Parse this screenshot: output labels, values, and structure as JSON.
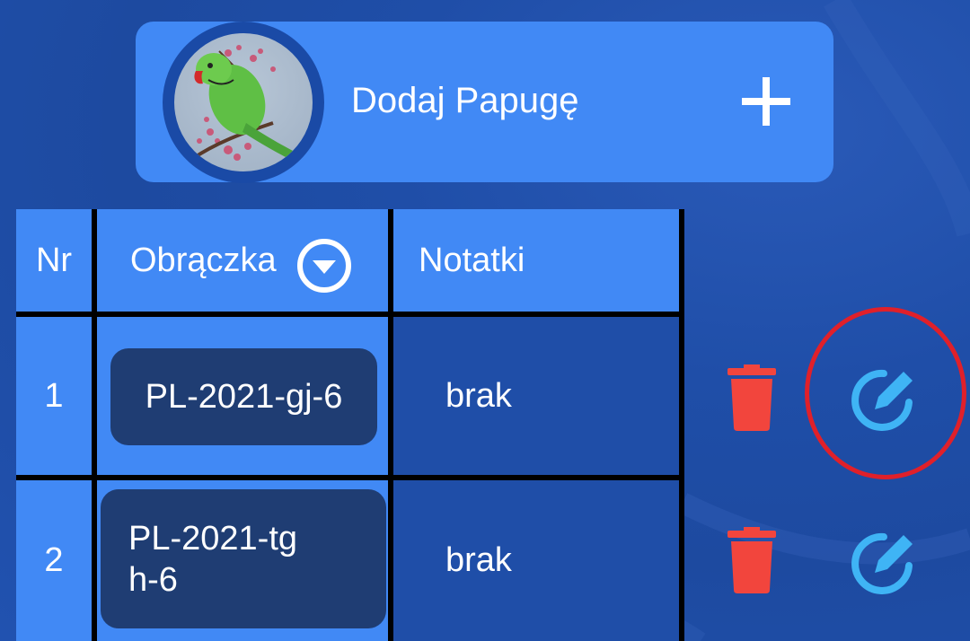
{
  "header": {
    "add_label": "Dodaj Papugę",
    "avatar_icon": "parrot-avatar",
    "add_icon": "plus-icon"
  },
  "table": {
    "columns": [
      "Nr",
      "Obrączka",
      "Notatki"
    ],
    "sort_icon": "chevron-down-circle-icon",
    "rows": [
      {
        "nr": "1",
        "ring_line1": "PL-2021-gj-6",
        "ring_line2": "",
        "notes": "brak"
      },
      {
        "nr": "2",
        "ring_line1": "PL-2021-tg",
        "ring_line2": "h-6",
        "notes": "brak"
      }
    ]
  },
  "actions": {
    "delete_icon": "trash-icon",
    "edit_icon": "edit-pencil-icon"
  },
  "colors": {
    "background": "#1f4ea8",
    "card": "#4189f5",
    "pill": "#1f3d73",
    "delete": "#f2453d",
    "edit": "#3fb4f5",
    "highlight": "#e0202a"
  }
}
